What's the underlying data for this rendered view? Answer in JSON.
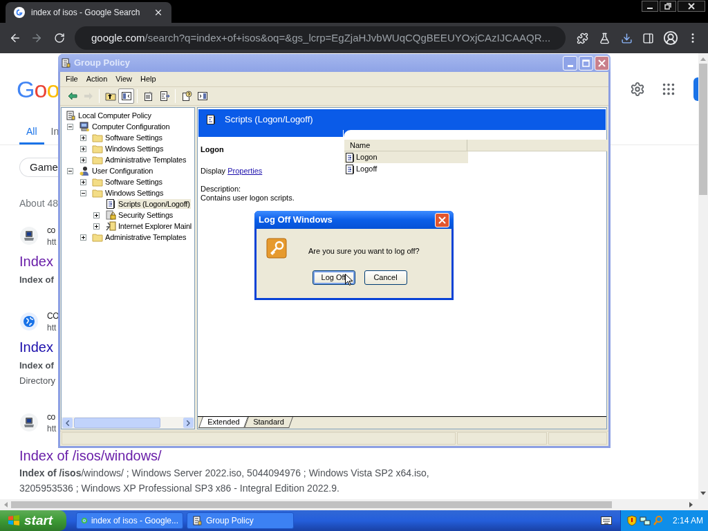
{
  "browser": {
    "tab": {
      "title": "index of isos - Google Search"
    },
    "address": {
      "host": "google.com",
      "path": "/search?q=index+of+isos&oq=&gs_lcrp=EgZjaHJvbWUqCQgBEEUYOxjCAzIJCAAQR..."
    }
  },
  "google": {
    "logo": "Goo",
    "tabs": [
      {
        "label": "All",
        "selected": true
      },
      {
        "label": "In",
        "selected": false
      }
    ],
    "chip": "Game",
    "stats": "About 48",
    "results": [
      {
        "kind": "computer",
        "site": "co",
        "url": "htt",
        "title": "Index",
        "visited": true,
        "lines": [
          {
            "text": "Index of",
            "bold": true
          }
        ]
      },
      {
        "kind": "globe",
        "site": "CO",
        "url": "htt",
        "title": "Index",
        "visited": false,
        "lines": [
          {
            "text": "Index of",
            "bold": true
          },
          {
            "text": "Directory",
            "bold": false
          }
        ]
      },
      {
        "kind": "computer",
        "site": "co",
        "url": "htt",
        "title": "Index of /isos/windows/",
        "visited": true,
        "lines": [
          {
            "text": "**Index of /isos**/windows/ ; Windows Server 2022.iso, 5044094976 ; Windows Vista SP2 x64.iso,",
            "bold": false
          },
          {
            "text": "3205953536 ; Windows XP Professional SP3 x86 - Integral Edition 2022.9.",
            "bold": false
          }
        ]
      }
    ]
  },
  "group_policy": {
    "title": "Group Policy",
    "menu": [
      "File",
      "Action",
      "View",
      "Help"
    ],
    "toolbar": [
      {
        "kind": "back",
        "disabled": false,
        "pressed": false
      },
      {
        "kind": "forward",
        "disabled": true,
        "pressed": false
      },
      {
        "kind": "separator"
      },
      {
        "kind": "up-folder",
        "disabled": false,
        "pressed": false
      },
      {
        "kind": "console-tree",
        "disabled": false,
        "pressed": true
      },
      {
        "kind": "separator"
      },
      {
        "kind": "properties",
        "disabled": false,
        "pressed": false
      },
      {
        "kind": "export",
        "disabled": false,
        "pressed": false
      },
      {
        "kind": "separator"
      },
      {
        "kind": "help",
        "disabled": false,
        "pressed": false
      },
      {
        "kind": "panel",
        "disabled": false,
        "pressed": false
      }
    ],
    "tree": [
      {
        "label": "Local Computer Policy",
        "kind": "policy",
        "selected": false,
        "children": [
          {
            "label": "Computer Configuration",
            "kind": "computer",
            "expanded": true,
            "selected": false,
            "children": [
              {
                "label": "Software Settings",
                "kind": "folder",
                "expanded": false,
                "selected": false
              },
              {
                "label": "Windows Settings",
                "kind": "folder",
                "expanded": false,
                "selected": false
              },
              {
                "label": "Administrative Templates",
                "kind": "folder",
                "expanded": false,
                "selected": false
              }
            ]
          },
          {
            "label": "User Configuration",
            "kind": "user",
            "expanded": true,
            "selected": false,
            "children": [
              {
                "label": "Software Settings",
                "kind": "folder",
                "expanded": false,
                "selected": false
              },
              {
                "label": "Windows Settings",
                "kind": "folder",
                "expanded": true,
                "selected": false,
                "children": [
                  {
                    "label": "Scripts (Logon/Logoff)",
                    "kind": "script",
                    "selected": true
                  },
                  {
                    "label": "Security Settings",
                    "kind": "security",
                    "expanded": false,
                    "selected": false
                  },
                  {
                    "label": "Internet Explorer Mainl",
                    "kind": "ie",
                    "expanded": false,
                    "selected": false
                  }
                ]
              },
              {
                "label": "Administrative Templates",
                "kind": "folder",
                "expanded": false,
                "selected": false
              }
            ]
          }
        ]
      }
    ],
    "header": "Scripts (Logon/Logoff)",
    "detail": {
      "title": "Logon",
      "display_prefix": "Display",
      "link": "Properties",
      "description_label": "Description:",
      "description": "Contains user logon scripts."
    },
    "list": {
      "columns": [
        "Name"
      ],
      "items": [
        {
          "label": "Logon",
          "selected": true
        },
        {
          "label": "Logoff",
          "selected": false
        }
      ]
    },
    "view_tabs": [
      {
        "label": "Extended",
        "selected": true
      },
      {
        "label": "Standard",
        "selected": false
      }
    ]
  },
  "dialog": {
    "title": "Log Off Windows",
    "message": "Are you sure you want to log off?",
    "buttons": [
      {
        "label": "Log Off",
        "default": true
      },
      {
        "label": "Cancel",
        "default": false
      }
    ]
  },
  "taskbar": {
    "start": "start",
    "tasks": [
      {
        "label": "index of isos - Google...",
        "kind": "browser"
      },
      {
        "label": "Group Policy",
        "kind": "policy"
      }
    ],
    "clock": "2:14 AM"
  }
}
